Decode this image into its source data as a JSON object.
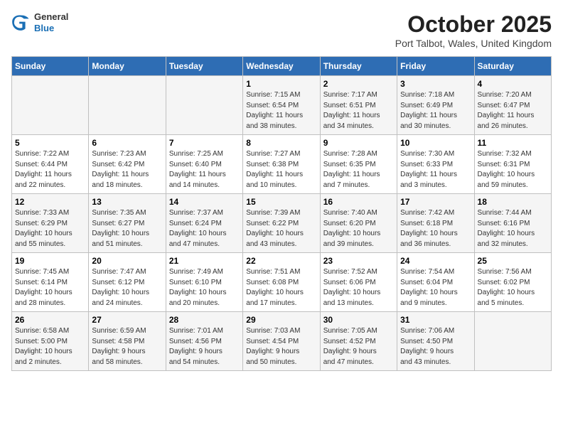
{
  "logo": {
    "general": "General",
    "blue": "Blue"
  },
  "title": "October 2025",
  "subtitle": "Port Talbot, Wales, United Kingdom",
  "weekdays": [
    "Sunday",
    "Monday",
    "Tuesday",
    "Wednesday",
    "Thursday",
    "Friday",
    "Saturday"
  ],
  "weeks": [
    [
      {
        "day": "",
        "info": ""
      },
      {
        "day": "",
        "info": ""
      },
      {
        "day": "",
        "info": ""
      },
      {
        "day": "1",
        "info": "Sunrise: 7:15 AM\nSunset: 6:54 PM\nDaylight: 11 hours\nand 38 minutes."
      },
      {
        "day": "2",
        "info": "Sunrise: 7:17 AM\nSunset: 6:51 PM\nDaylight: 11 hours\nand 34 minutes."
      },
      {
        "day": "3",
        "info": "Sunrise: 7:18 AM\nSunset: 6:49 PM\nDaylight: 11 hours\nand 30 minutes."
      },
      {
        "day": "4",
        "info": "Sunrise: 7:20 AM\nSunset: 6:47 PM\nDaylight: 11 hours\nand 26 minutes."
      }
    ],
    [
      {
        "day": "5",
        "info": "Sunrise: 7:22 AM\nSunset: 6:44 PM\nDaylight: 11 hours\nand 22 minutes."
      },
      {
        "day": "6",
        "info": "Sunrise: 7:23 AM\nSunset: 6:42 PM\nDaylight: 11 hours\nand 18 minutes."
      },
      {
        "day": "7",
        "info": "Sunrise: 7:25 AM\nSunset: 6:40 PM\nDaylight: 11 hours\nand 14 minutes."
      },
      {
        "day": "8",
        "info": "Sunrise: 7:27 AM\nSunset: 6:38 PM\nDaylight: 11 hours\nand 10 minutes."
      },
      {
        "day": "9",
        "info": "Sunrise: 7:28 AM\nSunset: 6:35 PM\nDaylight: 11 hours\nand 7 minutes."
      },
      {
        "day": "10",
        "info": "Sunrise: 7:30 AM\nSunset: 6:33 PM\nDaylight: 11 hours\nand 3 minutes."
      },
      {
        "day": "11",
        "info": "Sunrise: 7:32 AM\nSunset: 6:31 PM\nDaylight: 10 hours\nand 59 minutes."
      }
    ],
    [
      {
        "day": "12",
        "info": "Sunrise: 7:33 AM\nSunset: 6:29 PM\nDaylight: 10 hours\nand 55 minutes."
      },
      {
        "day": "13",
        "info": "Sunrise: 7:35 AM\nSunset: 6:27 PM\nDaylight: 10 hours\nand 51 minutes."
      },
      {
        "day": "14",
        "info": "Sunrise: 7:37 AM\nSunset: 6:24 PM\nDaylight: 10 hours\nand 47 minutes."
      },
      {
        "day": "15",
        "info": "Sunrise: 7:39 AM\nSunset: 6:22 PM\nDaylight: 10 hours\nand 43 minutes."
      },
      {
        "day": "16",
        "info": "Sunrise: 7:40 AM\nSunset: 6:20 PM\nDaylight: 10 hours\nand 39 minutes."
      },
      {
        "day": "17",
        "info": "Sunrise: 7:42 AM\nSunset: 6:18 PM\nDaylight: 10 hours\nand 36 minutes."
      },
      {
        "day": "18",
        "info": "Sunrise: 7:44 AM\nSunset: 6:16 PM\nDaylight: 10 hours\nand 32 minutes."
      }
    ],
    [
      {
        "day": "19",
        "info": "Sunrise: 7:45 AM\nSunset: 6:14 PM\nDaylight: 10 hours\nand 28 minutes."
      },
      {
        "day": "20",
        "info": "Sunrise: 7:47 AM\nSunset: 6:12 PM\nDaylight: 10 hours\nand 24 minutes."
      },
      {
        "day": "21",
        "info": "Sunrise: 7:49 AM\nSunset: 6:10 PM\nDaylight: 10 hours\nand 20 minutes."
      },
      {
        "day": "22",
        "info": "Sunrise: 7:51 AM\nSunset: 6:08 PM\nDaylight: 10 hours\nand 17 minutes."
      },
      {
        "day": "23",
        "info": "Sunrise: 7:52 AM\nSunset: 6:06 PM\nDaylight: 10 hours\nand 13 minutes."
      },
      {
        "day": "24",
        "info": "Sunrise: 7:54 AM\nSunset: 6:04 PM\nDaylight: 10 hours\nand 9 minutes."
      },
      {
        "day": "25",
        "info": "Sunrise: 7:56 AM\nSunset: 6:02 PM\nDaylight: 10 hours\nand 5 minutes."
      }
    ],
    [
      {
        "day": "26",
        "info": "Sunrise: 6:58 AM\nSunset: 5:00 PM\nDaylight: 10 hours\nand 2 minutes."
      },
      {
        "day": "27",
        "info": "Sunrise: 6:59 AM\nSunset: 4:58 PM\nDaylight: 9 hours\nand 58 minutes."
      },
      {
        "day": "28",
        "info": "Sunrise: 7:01 AM\nSunset: 4:56 PM\nDaylight: 9 hours\nand 54 minutes."
      },
      {
        "day": "29",
        "info": "Sunrise: 7:03 AM\nSunset: 4:54 PM\nDaylight: 9 hours\nand 50 minutes."
      },
      {
        "day": "30",
        "info": "Sunrise: 7:05 AM\nSunset: 4:52 PM\nDaylight: 9 hours\nand 47 minutes."
      },
      {
        "day": "31",
        "info": "Sunrise: 7:06 AM\nSunset: 4:50 PM\nDaylight: 9 hours\nand 43 minutes."
      },
      {
        "day": "",
        "info": ""
      }
    ]
  ]
}
